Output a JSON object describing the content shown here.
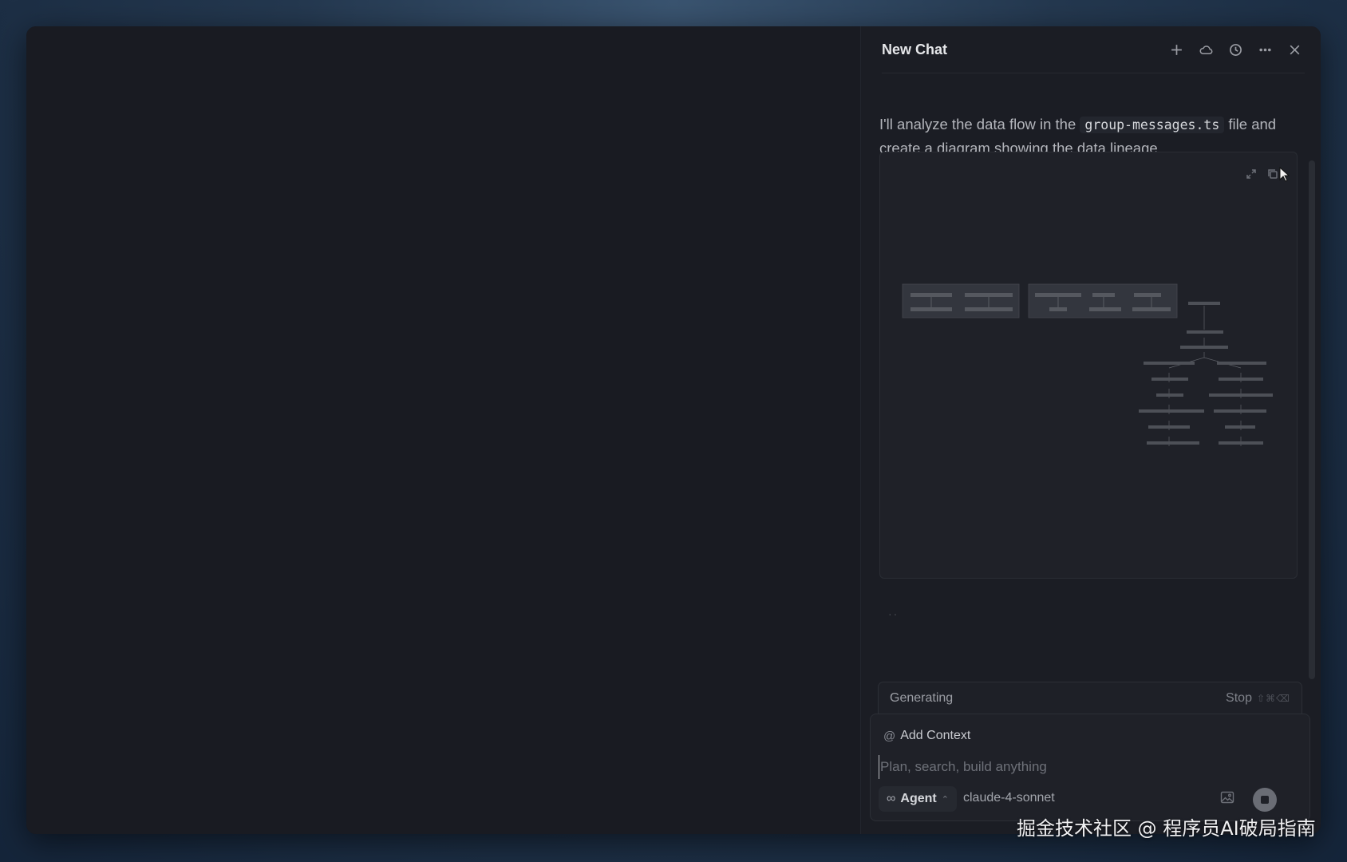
{
  "chat": {
    "title": "New Chat",
    "header_icons": [
      "plus-icon",
      "cloud-icon",
      "history-icon",
      "more-icon",
      "close-icon"
    ],
    "message": {
      "before_code": "I'll analyze the data flow in the ",
      "code": "group-messages.ts",
      "after_code": " file and create a diagram showing the data lineage."
    },
    "loading_dots": "··",
    "generating_label": "Generating",
    "stop_label": "Stop",
    "stop_shortcut": "⇧⌘⌫"
  },
  "composer": {
    "add_context_label": "Add Context",
    "input_placeholder": "Plan, search, build anything",
    "agent_label": "Agent",
    "model_label": "claude-4-sonnet"
  },
  "watermark": "掘金技术社区 @ 程序员AI破局指南",
  "colors": {
    "window_bg": "#191b22",
    "panel_bg": "#1b1d24",
    "card_bg": "#1f2128"
  }
}
